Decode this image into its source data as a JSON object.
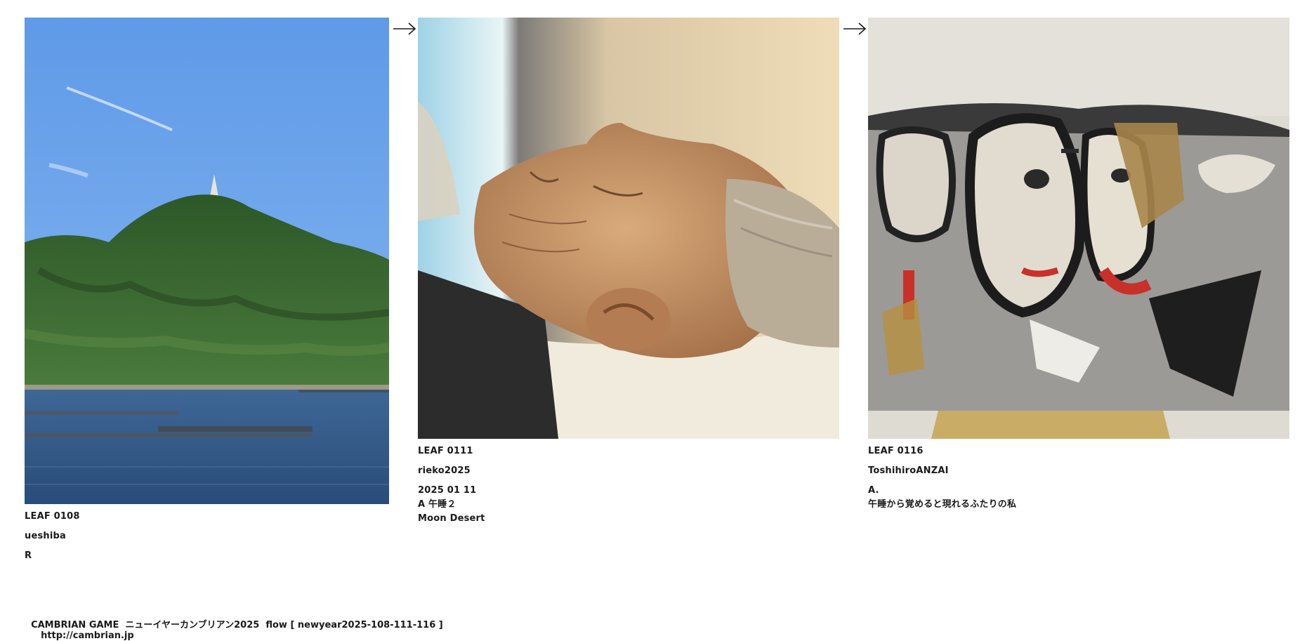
{
  "leaves": [
    {
      "id": "LEAF 0108",
      "author": "ueshiba",
      "lines": [
        "R"
      ]
    },
    {
      "id": "LEAF 0111",
      "author": "rieko2025",
      "lines": [
        "2025 01 11",
        "A 午睡２",
        "Moon Desert"
      ]
    },
    {
      "id": "LEAF 0116",
      "author": "ToshihiroANZAI",
      "lines": [
        "A.",
        "午睡から覚めると現れるふたりの私"
      ]
    }
  ],
  "footer": {
    "text": "CAMBRIAN GAME  ニューイヤーカンブリアン2025  flow [ newyear2025-108-111-116 ]",
    "url": "http://cambrian.jp"
  },
  "colors": {
    "sky": "#6fa6ec",
    "hill": "#2f5a2a",
    "sea": "#35598a",
    "skin": "#c99a6a",
    "hair": "#b7aa95",
    "canvas": "#dcd8d0",
    "ink": "#1a1a1a",
    "accent_red": "#c8302a",
    "ochre": "#b7903e"
  }
}
